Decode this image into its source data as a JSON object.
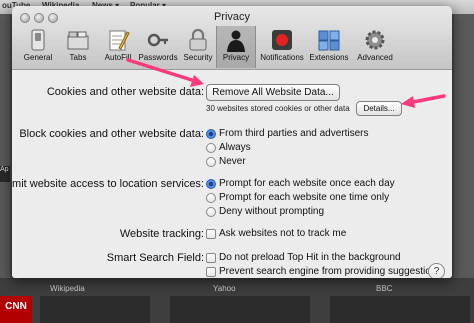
{
  "background": {
    "tabs": [
      "ouTube",
      "Wikipedia",
      "News ▾",
      "Popular ▾"
    ],
    "thumb_labels": [
      "Wikipedia",
      "Yahoo",
      "BBC"
    ],
    "side_tag": "Ap",
    "cnn_logo": "CNN"
  },
  "window": {
    "title": "Privacy"
  },
  "toolbar": {
    "items": [
      {
        "label": "General",
        "icon": "switch-icon"
      },
      {
        "label": "Tabs",
        "icon": "tabs-icon"
      },
      {
        "label": "AutoFill",
        "icon": "autofill-icon"
      },
      {
        "label": "Passwords",
        "icon": "key-icon"
      },
      {
        "label": "Security",
        "icon": "lock-icon"
      },
      {
        "label": "Privacy",
        "icon": "silhouette-icon",
        "selected": true
      },
      {
        "label": "Notifications",
        "icon": "notifications-icon"
      },
      {
        "label": "Extensions",
        "icon": "puzzle-icon"
      },
      {
        "label": "Advanced",
        "icon": "gear-icon"
      }
    ]
  },
  "cookies": {
    "label": "Cookies and other website data:",
    "remove_all_label": "Remove All Website Data...",
    "stored_note": "30 websites stored cookies or other data",
    "details_label": "Details..."
  },
  "block_cookies": {
    "label": "Block cookies and other website data:",
    "options": [
      "From third parties and advertisers",
      "Always",
      "Never"
    ],
    "selected_index": 0
  },
  "location": {
    "label": "Limit website access to location services:",
    "options": [
      "Prompt for each website once each day",
      "Prompt for each website one time only",
      "Deny without prompting"
    ],
    "selected_index": 0
  },
  "tracking": {
    "label": "Website tracking:",
    "checkbox_label": "Ask websites not to track me"
  },
  "smart_search": {
    "label": "Smart Search Field:",
    "options": [
      "Do not preload Top Hit in the background",
      "Prevent search engine from providing suggestions"
    ]
  },
  "help_label": "?",
  "colors": {
    "arrow": "#ff3a7a",
    "radio_selected": "#3a78d8"
  }
}
